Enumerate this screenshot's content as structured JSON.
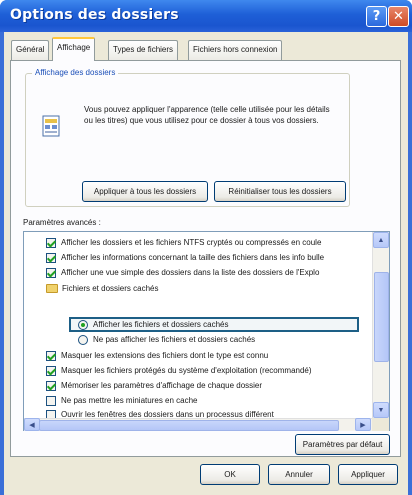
{
  "window": {
    "title": "Options des dossiers"
  },
  "titlebar": {
    "help_glyph": "?",
    "close_glyph": "✕"
  },
  "tabs": [
    {
      "label": "Général"
    },
    {
      "label": "Affichage"
    },
    {
      "label": "Types de fichiers"
    },
    {
      "label": "Fichiers hors connexion"
    }
  ],
  "active_tab": "Affichage",
  "folder_views": {
    "legend": "Affichage des dossiers",
    "description": "Vous pouvez appliquer l'apparence (telle celle utilisée pour les détails ou les titres) que vous utilisez pour ce dossier à tous vos dossiers.",
    "apply_all_label": "Appliquer à tous les dossiers",
    "reset_all_label": "Réinitialiser tous les dossiers"
  },
  "advanced": {
    "label": "Paramètres avancés :",
    "items": [
      {
        "type": "checkbox",
        "checked": true,
        "label": "Afficher les dossiers et les fichiers NTFS cryptés ou compressés en coule"
      },
      {
        "type": "checkbox",
        "checked": true,
        "label": "Afficher les informations concernant la taille des fichiers dans les info bulle"
      },
      {
        "type": "checkbox",
        "checked": true,
        "label": "Afficher une vue simple des dossiers dans la liste des dossiers de l'Explo"
      },
      {
        "type": "folder",
        "label": "Fichiers et dossiers cachés"
      },
      {
        "type": "radio",
        "checked": true,
        "label": "Afficher les fichiers et dossiers cachés"
      },
      {
        "type": "radio",
        "checked": false,
        "label": "Ne pas afficher les fichiers et dossiers cachés"
      },
      {
        "type": "checkbox",
        "checked": true,
        "label": "Masquer les extensions des fichiers dont le type est connu"
      },
      {
        "type": "checkbox",
        "checked": true,
        "label": "Masquer les fichiers protégés du système d'exploitation (recommandé)"
      },
      {
        "type": "checkbox",
        "checked": true,
        "label": "Mémoriser les paramètres d'affichage de chaque dossier"
      },
      {
        "type": "checkbox",
        "checked": false,
        "label": "Ne pas mettre les miniatures en cache"
      },
      {
        "type": "checkbox",
        "checked": false,
        "label": "Ouvrir les fenêtres des dossiers dans un processus différent"
      }
    ],
    "restore_defaults_label": "Paramètres par défaut"
  },
  "footer": {
    "ok_label": "OK",
    "cancel_label": "Annuler",
    "apply_label": "Appliquer"
  },
  "colors": {
    "titlebar": "#1e5fd7",
    "highlight_border": "#1d5f86",
    "dialog_bg": "#ece9d8"
  }
}
